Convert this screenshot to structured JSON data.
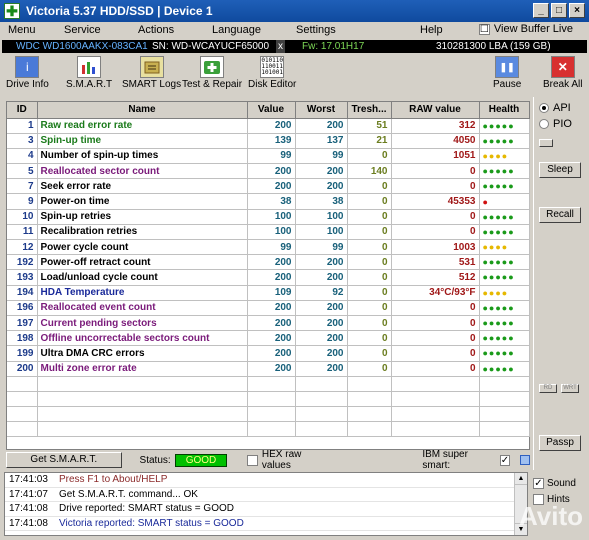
{
  "window": {
    "title": "Victoria 5.37 HDD/SSD | Device 1",
    "controls": [
      "_",
      "□",
      "×"
    ]
  },
  "menu": {
    "items": [
      "Menu",
      "Service",
      "Actions",
      "Language",
      "Settings",
      "Help"
    ],
    "view_buffer_label": "View Buffer Live",
    "view_buffer_checked": "☐"
  },
  "device": {
    "model": "WDC WD1600AAKX-083CA1",
    "sn": "SN: WD-WCAYUCF65000",
    "close": "x",
    "fw": "Fw: 17.01H17",
    "lba": "310281300 LBA (159 GB)"
  },
  "toolbar": {
    "drive_info": "Drive Info",
    "smart": "S.M.A.R.T",
    "smart_logs": "SMART Logs",
    "test_repair": "Test & Repair",
    "disk_editor": "Disk Editor",
    "pause": "Pause",
    "break_all": "Break All"
  },
  "table": {
    "headers": {
      "id": "ID",
      "name": "Name",
      "value": "Value",
      "worst": "Worst",
      "thresh": "Tresh...",
      "raw": "RAW value",
      "health": "Health"
    },
    "rows": [
      {
        "id": "1",
        "name": "Raw read error rate",
        "value": "200",
        "worst": "200",
        "thresh": "51",
        "raw": "312",
        "health": "●●●●●",
        "name_color": "#1a7a1a",
        "health_color": "#1a9a1a"
      },
      {
        "id": "3",
        "name": "Spin-up time",
        "value": "139",
        "worst": "137",
        "thresh": "21",
        "raw": "4050",
        "health": "●●●●●",
        "name_color": "#1a7a1a",
        "health_color": "#1a9a1a"
      },
      {
        "id": "4",
        "name": "Number of spin-up times",
        "value": "99",
        "worst": "99",
        "thresh": "0",
        "raw": "1051",
        "health": "●●●●",
        "name_color": "#000000",
        "health_color": "#e6b800"
      },
      {
        "id": "5",
        "name": "Reallocated sector count",
        "value": "200",
        "worst": "200",
        "thresh": "140",
        "raw": "0",
        "health": "●●●●●",
        "name_color": "#7a1a7a",
        "health_color": "#1a9a1a"
      },
      {
        "id": "7",
        "name": "Seek error rate",
        "value": "200",
        "worst": "200",
        "thresh": "0",
        "raw": "0",
        "health": "●●●●●",
        "name_color": "#000000",
        "health_color": "#1a9a1a"
      },
      {
        "id": "9",
        "name": "Power-on time",
        "value": "38",
        "worst": "38",
        "thresh": "0",
        "raw": "45353",
        "health": "●",
        "name_color": "#000000",
        "health_color": "#d01010"
      },
      {
        "id": "10",
        "name": "Spin-up retries",
        "value": "100",
        "worst": "100",
        "thresh": "0",
        "raw": "0",
        "health": "●●●●●",
        "name_color": "#000000",
        "health_color": "#1a9a1a"
      },
      {
        "id": "11",
        "name": "Recalibration retries",
        "value": "100",
        "worst": "100",
        "thresh": "0",
        "raw": "0",
        "health": "●●●●●",
        "name_color": "#000000",
        "health_color": "#1a9a1a"
      },
      {
        "id": "12",
        "name": "Power cycle count",
        "value": "99",
        "worst": "99",
        "thresh": "0",
        "raw": "1003",
        "health": "●●●●",
        "name_color": "#000000",
        "health_color": "#e6b800"
      },
      {
        "id": "192",
        "name": "Power-off retract count",
        "value": "200",
        "worst": "200",
        "thresh": "0",
        "raw": "531",
        "health": "●●●●●",
        "name_color": "#000000",
        "health_color": "#1a9a1a"
      },
      {
        "id": "193",
        "name": "Load/unload cycle count",
        "value": "200",
        "worst": "200",
        "thresh": "0",
        "raw": "512",
        "health": "●●●●●",
        "name_color": "#000000",
        "health_color": "#1a9a1a"
      },
      {
        "id": "194",
        "name": "HDA Temperature",
        "value": "109",
        "worst": "92",
        "thresh": "0",
        "raw": "34°C/93°F",
        "health": "●●●●",
        "name_color": "#1a2a9a",
        "health_color": "#e6b800"
      },
      {
        "id": "196",
        "name": "Reallocated event count",
        "value": "200",
        "worst": "200",
        "thresh": "0",
        "raw": "0",
        "health": "●●●●●",
        "name_color": "#7a1a7a",
        "health_color": "#1a9a1a"
      },
      {
        "id": "197",
        "name": "Current pending sectors",
        "value": "200",
        "worst": "200",
        "thresh": "0",
        "raw": "0",
        "health": "●●●●●",
        "name_color": "#7a1a7a",
        "health_color": "#1a9a1a"
      },
      {
        "id": "198",
        "name": "Offline uncorrectable sectors count",
        "value": "200",
        "worst": "200",
        "thresh": "0",
        "raw": "0",
        "health": "●●●●●",
        "name_color": "#7a1a7a",
        "health_color": "#1a9a1a"
      },
      {
        "id": "199",
        "name": "Ultra DMA CRC errors",
        "value": "200",
        "worst": "200",
        "thresh": "0",
        "raw": "0",
        "health": "●●●●●",
        "name_color": "#000000",
        "health_color": "#1a9a1a"
      },
      {
        "id": "200",
        "name": "Multi zone error rate",
        "value": "200",
        "worst": "200",
        "thresh": "0",
        "raw": "0",
        "health": "●●●●●",
        "name_color": "#7a1a7a",
        "health_color": "#1a9a1a"
      }
    ]
  },
  "status_row": {
    "get_smart": "Get S.M.A.R.T.",
    "status_label": "Status:",
    "status_value": "GOOD",
    "hex_label": "HEX raw values",
    "ibm_label": "IBM super smart:",
    "ibm_checked": "✓"
  },
  "right_panel": {
    "api": "API",
    "pio": "PIO",
    "sleep": "Sleep",
    "recall": "Recall",
    "passp": "Passp",
    "rd": "RD",
    "wrt": "WRT"
  },
  "log": [
    {
      "time": "17:41:03",
      "msg": "Press F1 to About/HELP",
      "color": "#8b2a2a"
    },
    {
      "time": "17:41:07",
      "msg": "Get S.M.A.R.T. command... OK",
      "color": "#000000"
    },
    {
      "time": "17:41:08",
      "msg": "Drive reported: SMART status = GOOD",
      "color": "#000000"
    },
    {
      "time": "17:41:08",
      "msg": "Victoria reported: SMART status = GOOD",
      "color": "#1a2a9a"
    }
  ],
  "sound_panel": {
    "sound": "Sound",
    "sound_checked": "✓",
    "hints": "Hints"
  },
  "watermark": "Avito"
}
